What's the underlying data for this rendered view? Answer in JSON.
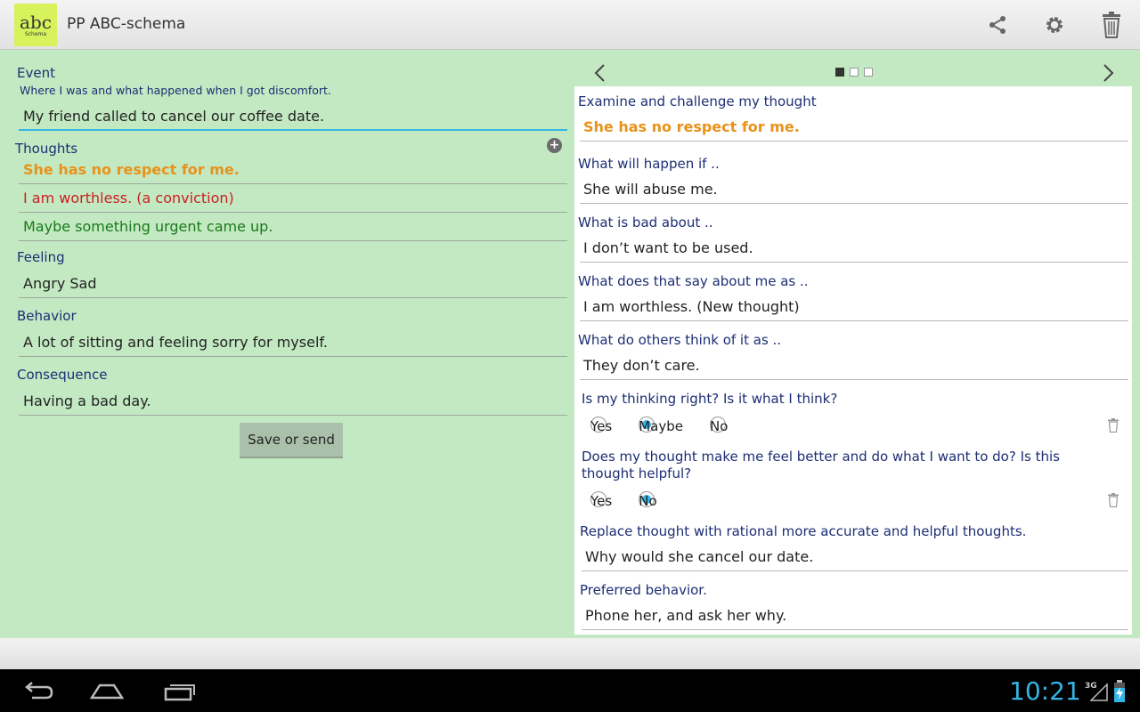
{
  "app": {
    "logo_main": "abc",
    "logo_sub": "Schema",
    "title": "PP ABC-schema"
  },
  "left": {
    "event_label": "Event",
    "event_hint": "Where I was and what happened when I got discomfort.",
    "event_value": "My friend called to cancel our coffee date.",
    "thoughts_label": "Thoughts",
    "thoughts": [
      {
        "text": "She has no respect for me.",
        "color": "#e8921a"
      },
      {
        "text": "I am worthless. (a conviction)",
        "color": "#cc1f1f"
      },
      {
        "text": "Maybe something urgent came up.",
        "color": "#1a7a1a"
      }
    ],
    "feeling_label": "Feeling",
    "feeling_value": "Angry Sad",
    "behavior_label": "Behavior",
    "behavior_value": "A lot of sitting and feeling sorry for myself.",
    "consequence_label": "Consequence",
    "consequence_value": "Having a bad day.",
    "save_label": "Save or send"
  },
  "right": {
    "examine_label": "Examine and challenge my thought",
    "examine_value": "She has no respect for me.",
    "q1_label": "What will happen if ..",
    "q1_value": "She will abuse me.",
    "q2_label": "What is bad about ..",
    "q2_value": "I don’t want to be used.",
    "q3_label": "What does that say about me as ..",
    "q3_value": "I am worthless. (New thought)",
    "q4_label": "What do others think of it as ..",
    "q4_value": "They don’t care.",
    "q5_label": "Is my thinking right? Is it what I think?",
    "q5_options": [
      "Yes",
      "Maybe",
      "No"
    ],
    "q5_selected": "Maybe",
    "q6_label": "Does my thought make me feel better and do what I want to do? Is this thought helpful?",
    "q6_options": [
      "Yes",
      "No"
    ],
    "q6_selected": "No",
    "q7_label": "Replace thought with rational more accurate and helpful thoughts.",
    "q7_value": "Why would she cancel our date.",
    "q8_label": "Preferred behavior.",
    "q8_value": "Phone her, and ask her why."
  },
  "status": {
    "time": "10:21",
    "network": "3G"
  },
  "colors": {
    "accent": "#33b5e5",
    "panel_bg": "#c3e9c3",
    "label": "#1d2e74"
  }
}
